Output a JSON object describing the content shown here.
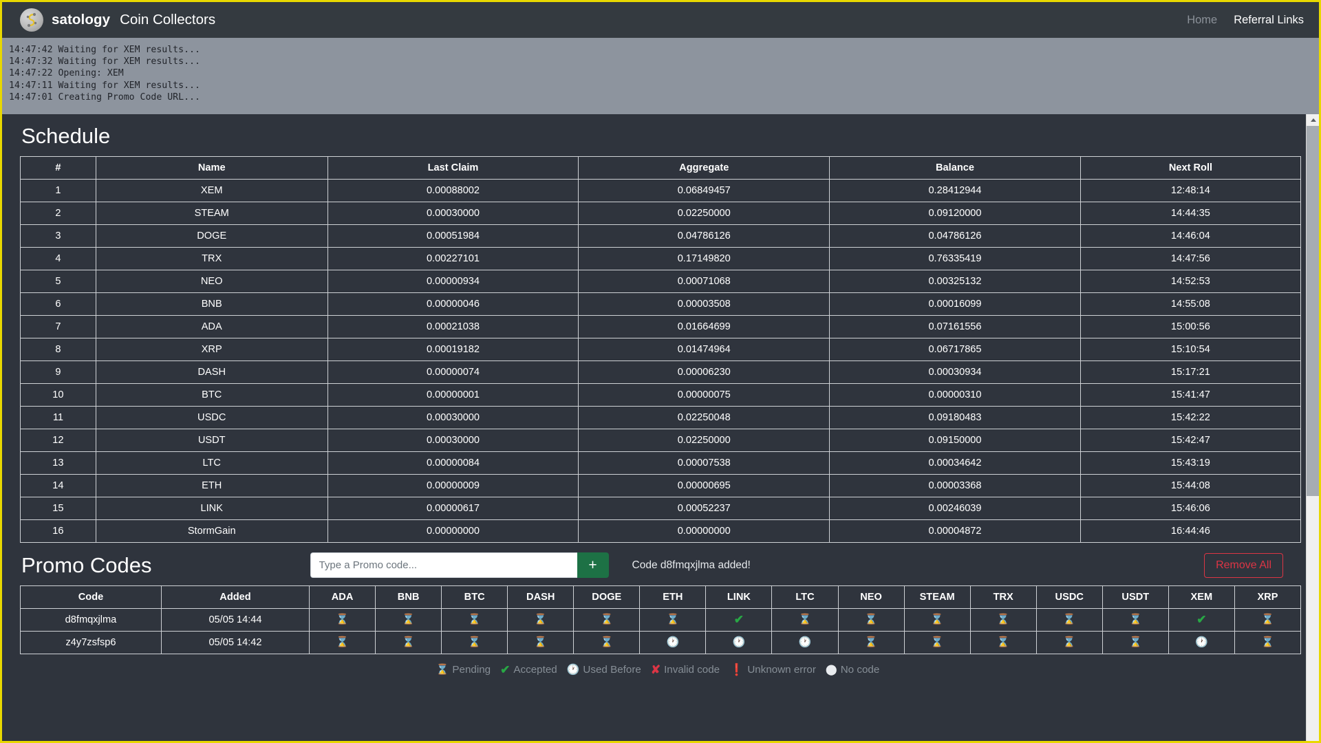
{
  "header": {
    "brand_name": "satology",
    "brand_sub": "Coin Collectors",
    "logo_icon": "satology-logo-icon",
    "nav": [
      {
        "label": "Home",
        "active": false
      },
      {
        "label": "Referral Links",
        "active": true
      }
    ]
  },
  "console_log": [
    "14:47:42 Waiting for XEM results...",
    "14:47:32 Waiting for XEM results...",
    "14:47:22 Opening: XEM",
    "14:47:11 Waiting for XEM results...",
    "14:47:01 Creating Promo Code URL..."
  ],
  "schedule": {
    "title": "Schedule",
    "columns": [
      "#",
      "Name",
      "Last Claim",
      "Aggregate",
      "Balance",
      "Next Roll"
    ],
    "rows": [
      {
        "num": "1",
        "name": "XEM",
        "last_claim": "0.00088002",
        "aggregate": "0.06849457",
        "balance": "0.28412944",
        "next_roll": "12:48:14"
      },
      {
        "num": "2",
        "name": "STEAM",
        "last_claim": "0.00030000",
        "aggregate": "0.02250000",
        "balance": "0.09120000",
        "next_roll": "14:44:35"
      },
      {
        "num": "3",
        "name": "DOGE",
        "last_claim": "0.00051984",
        "aggregate": "0.04786126",
        "balance": "0.04786126",
        "next_roll": "14:46:04"
      },
      {
        "num": "4",
        "name": "TRX",
        "last_claim": "0.00227101",
        "aggregate": "0.17149820",
        "balance": "0.76335419",
        "next_roll": "14:47:56"
      },
      {
        "num": "5",
        "name": "NEO",
        "last_claim": "0.00000934",
        "aggregate": "0.00071068",
        "balance": "0.00325132",
        "next_roll": "14:52:53"
      },
      {
        "num": "6",
        "name": "BNB",
        "last_claim": "0.00000046",
        "aggregate": "0.00003508",
        "balance": "0.00016099",
        "next_roll": "14:55:08"
      },
      {
        "num": "7",
        "name": "ADA",
        "last_claim": "0.00021038",
        "aggregate": "0.01664699",
        "balance": "0.07161556",
        "next_roll": "15:00:56"
      },
      {
        "num": "8",
        "name": "XRP",
        "last_claim": "0.00019182",
        "aggregate": "0.01474964",
        "balance": "0.06717865",
        "next_roll": "15:10:54"
      },
      {
        "num": "9",
        "name": "DASH",
        "last_claim": "0.00000074",
        "aggregate": "0.00006230",
        "balance": "0.00030934",
        "next_roll": "15:17:21"
      },
      {
        "num": "10",
        "name": "BTC",
        "last_claim": "0.00000001",
        "aggregate": "0.00000075",
        "balance": "0.00000310",
        "next_roll": "15:41:47"
      },
      {
        "num": "11",
        "name": "USDC",
        "last_claim": "0.00030000",
        "aggregate": "0.02250048",
        "balance": "0.09180483",
        "next_roll": "15:42:22"
      },
      {
        "num": "12",
        "name": "USDT",
        "last_claim": "0.00030000",
        "aggregate": "0.02250000",
        "balance": "0.09150000",
        "next_roll": "15:42:47"
      },
      {
        "num": "13",
        "name": "LTC",
        "last_claim": "0.00000084",
        "aggregate": "0.00007538",
        "balance": "0.00034642",
        "next_roll": "15:43:19"
      },
      {
        "num": "14",
        "name": "ETH",
        "last_claim": "0.00000009",
        "aggregate": "0.00000695",
        "balance": "0.00003368",
        "next_roll": "15:44:08"
      },
      {
        "num": "15",
        "name": "LINK",
        "last_claim": "0.00000617",
        "aggregate": "0.00052237",
        "balance": "0.00246039",
        "next_roll": "15:46:06"
      },
      {
        "num": "16",
        "name": "StormGain",
        "last_claim": "0.00000000",
        "aggregate": "0.00000000",
        "balance": "0.00004872",
        "next_roll": "16:44:46"
      }
    ]
  },
  "promo": {
    "title": "Promo Codes",
    "input_placeholder": "Type a Promo code...",
    "input_value": "",
    "add_button_label": "+",
    "add_button_icon": "plus-icon",
    "status_message": "Code d8fmqxjlma added!",
    "remove_all_label": "Remove All",
    "columns": [
      "Code",
      "Added",
      "ADA",
      "BNB",
      "BTC",
      "DASH",
      "DOGE",
      "ETH",
      "LINK",
      "LTC",
      "NEO",
      "STEAM",
      "TRX",
      "USDC",
      "USDT",
      "XEM",
      "XRP"
    ],
    "rows": [
      {
        "code": "d8fmqxjlma",
        "added": "05/05 14:44",
        "statuses": [
          "pending",
          "pending",
          "pending",
          "pending",
          "pending",
          "pending",
          "accepted",
          "pending",
          "pending",
          "pending",
          "pending",
          "pending",
          "pending",
          "accepted",
          "pending"
        ]
      },
      {
        "code": "z4y7zsfsp6",
        "added": "05/05 14:42",
        "statuses": [
          "pending",
          "pending",
          "pending",
          "pending",
          "pending",
          "used",
          "used",
          "used",
          "pending",
          "pending",
          "pending",
          "pending",
          "pending",
          "used",
          "pending"
        ]
      }
    ],
    "legend": [
      {
        "glyph": "⌛",
        "icon": "hourglass-icon",
        "label": "Pending",
        "cls": "g-pending"
      },
      {
        "glyph": "✔",
        "icon": "check-icon",
        "label": "Accepted",
        "cls": "g-accepted"
      },
      {
        "glyph": "🕐",
        "icon": "clock-icon",
        "label": "Used Before",
        "cls": "g-used"
      },
      {
        "glyph": "✘",
        "icon": "cross-icon",
        "label": "Invalid code",
        "cls": "g-invalid"
      },
      {
        "glyph": "❗",
        "icon": "exclamation-icon",
        "label": "Unknown error",
        "cls": "g-unknown"
      },
      {
        "glyph": "⬤",
        "icon": "circle-icon",
        "label": "No code",
        "cls": "g-nocode"
      }
    ]
  },
  "icon_glyphs": {
    "pending": "⌛",
    "accepted": "✔",
    "used": "🕐",
    "invalid": "✘",
    "unknown": "❗",
    "nocode": "⬤"
  },
  "colors": {
    "accent_border": "#e8d800",
    "panel_bg": "#2f343d",
    "navbar_bg": "#343a40",
    "log_bg": "#8d949e",
    "add_green": "#1d7145",
    "danger_red": "#dc3545",
    "accept_green": "#28a745"
  },
  "scrollbar": {
    "up_icon": "scroll-up-arrow-icon",
    "down_icon": "scroll-down-arrow-icon"
  }
}
